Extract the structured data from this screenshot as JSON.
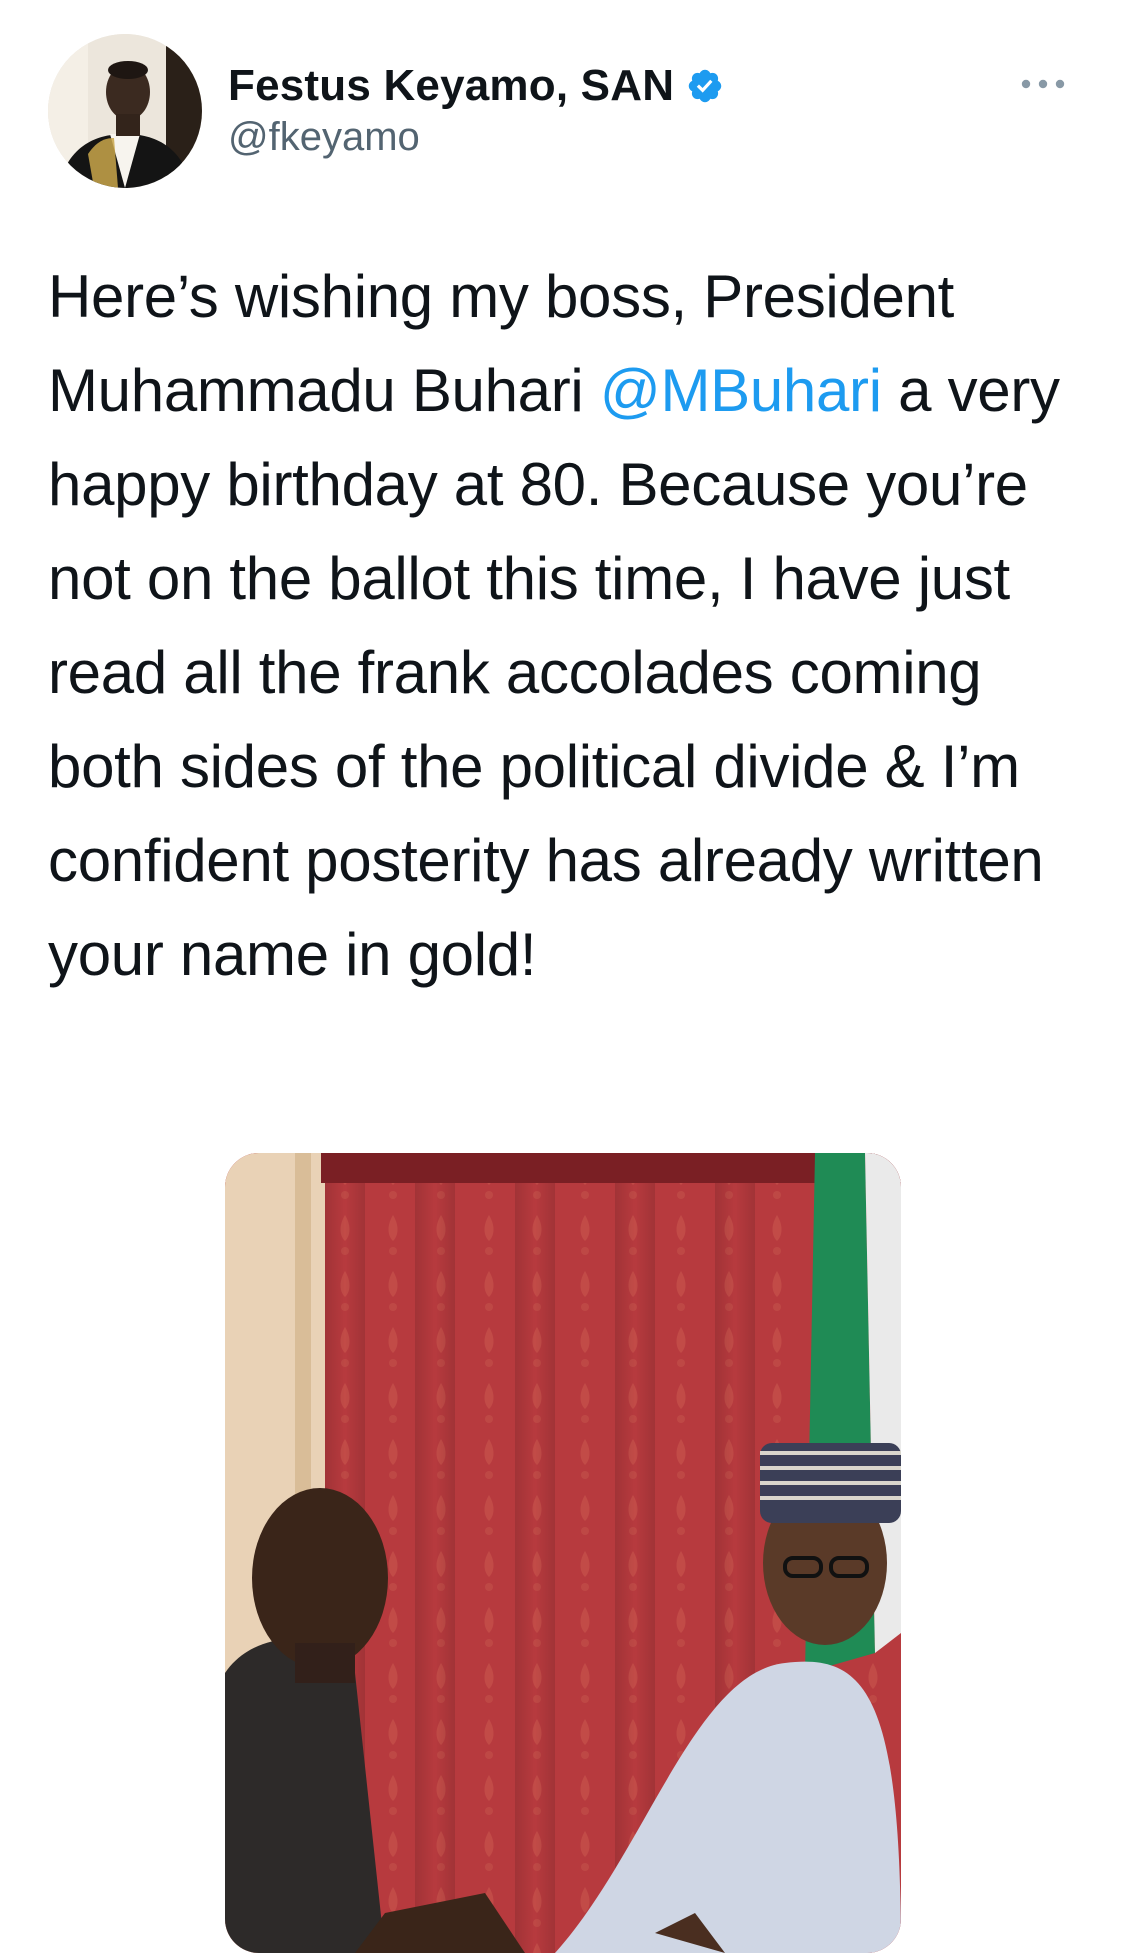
{
  "tweet": {
    "author": {
      "display_name": "Festus Keyamo, SAN",
      "handle": "@fkeyamo",
      "verified": true,
      "avatar_icon": "avatar-photo"
    },
    "more_icon": "more-horizontal-icon",
    "text_before_mention": "Here’s wishing my boss, President Muhammadu Buhari ",
    "mention": "@MBuhari",
    "text_after_mention": " a very happy birthday at 80. Because you’re not on the ballot this time, I have just read all the frank accolades coming both sides of the political divide & I’m confident posterity has already written your name in gold!",
    "media": {
      "type": "photo"
    }
  },
  "colors": {
    "text": "#0f1419",
    "secondary_text": "#536471",
    "link": "#1d9bf0",
    "verified_badge": "#1d9bf0",
    "background": "#ffffff"
  }
}
